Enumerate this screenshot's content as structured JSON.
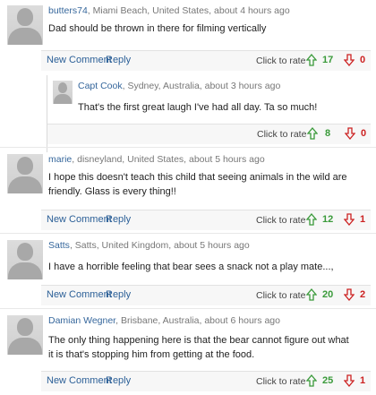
{
  "comments": [
    {
      "user": "butters74",
      "meta": ", Miami Beach, United States, about 4 hours ago",
      "text": "Dad should be thrown in there for filming vertically",
      "new_comment": "New Comment",
      "reply": "Reply",
      "rate_label": "Click to rate",
      "up": "17",
      "down": "0"
    },
    {
      "user": "Capt Cook",
      "meta": ", Sydney, Australia, about 3 hours ago",
      "text": "That's the first great laugh I've had all day. Ta so much!",
      "rate_label": "Click to rate",
      "up": "8",
      "down": "0"
    },
    {
      "user": "marie",
      "meta": ", disneyland, United States, about 5 hours ago",
      "text": "I hope this doesn't teach this child that seeing animals in the wild are friendly. Glass is every thing!!",
      "new_comment": "New Comment",
      "reply": "Reply",
      "rate_label": "Click to rate",
      "up": "12",
      "down": "1"
    },
    {
      "user": "Satts",
      "meta": ", Satts, United Kingdom, about 5 hours ago",
      "text": "I have a horrible feeling that bear sees a snack not a play mate...,",
      "new_comment": "New Comment",
      "reply": "Reply",
      "rate_label": "Click to rate",
      "up": "20",
      "down": "2"
    },
    {
      "user": "Damian Wegner",
      "meta": ", Brisbane, Australia, about 6 hours ago",
      "text": "The only thing happening here is that the bear cannot figure out what it is that's stopping him from getting at the food.",
      "new_comment": "New Comment",
      "reply": "Reply",
      "rate_label": "Click to rate",
      "up": "25",
      "down": "1"
    }
  ],
  "colors": {
    "up": "#3a9a3a",
    "down": "#cc2222",
    "link": "#2b5f97",
    "user": "#36679c"
  },
  "icons": {
    "up": "arrow-up-icon",
    "down": "arrow-down-icon",
    "avatar": "default-avatar"
  }
}
